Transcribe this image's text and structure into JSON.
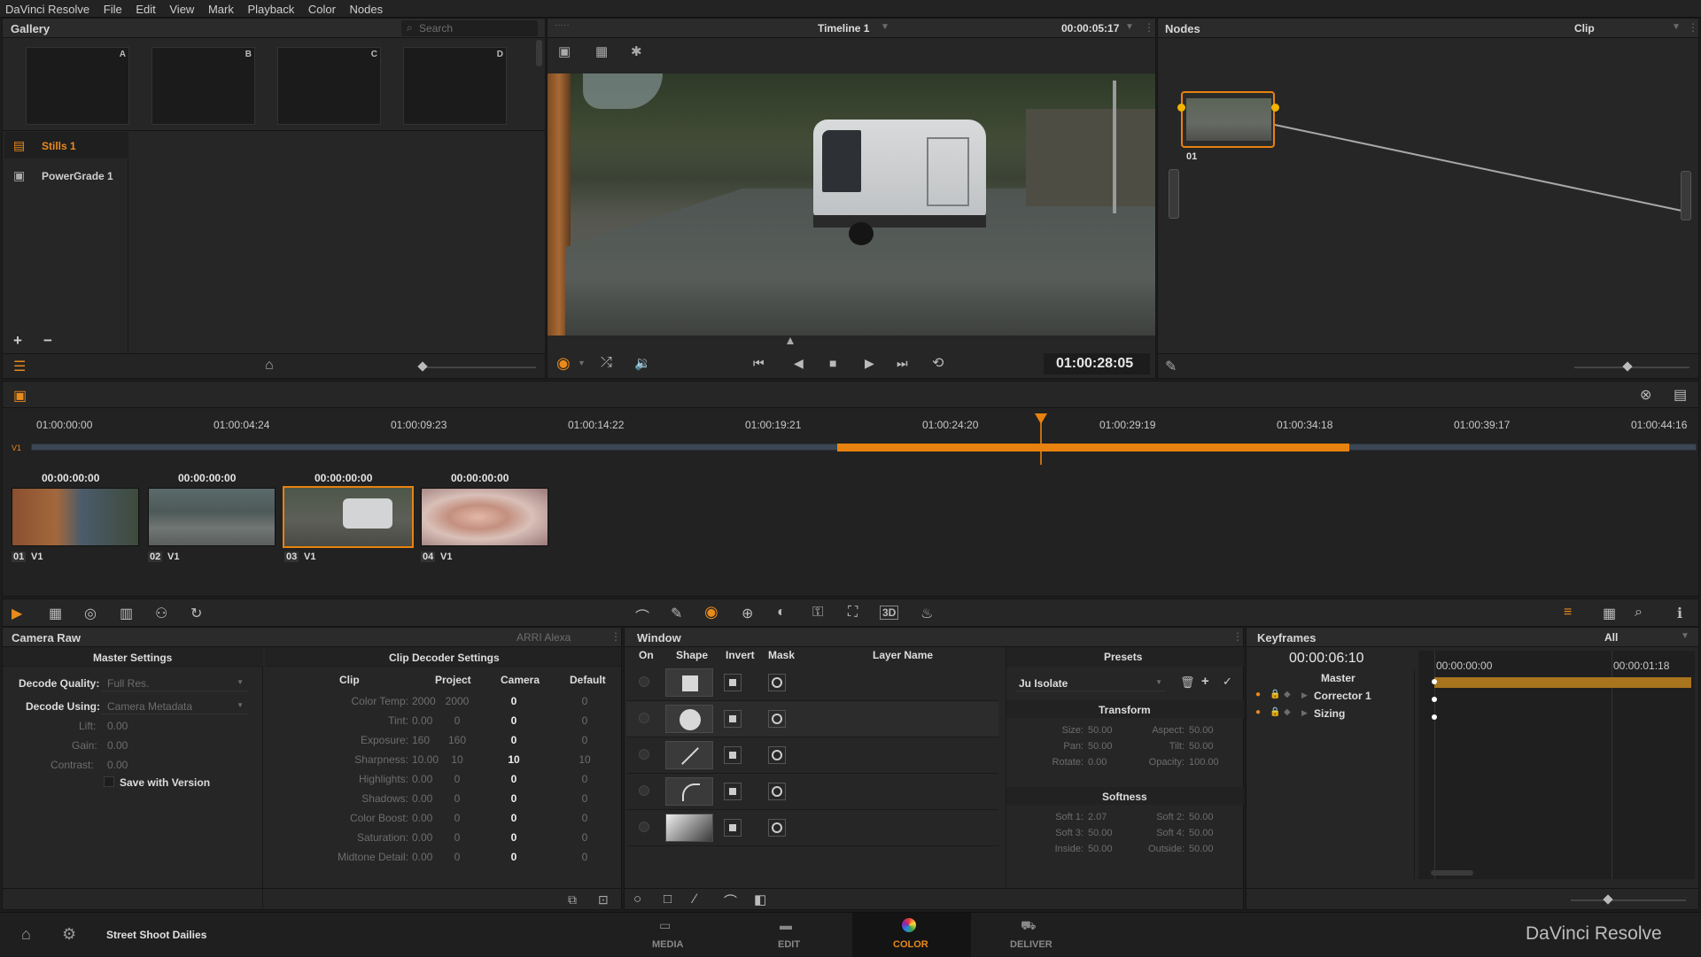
{
  "menu": {
    "items": [
      "DaVinci Resolve",
      "File",
      "Edit",
      "View",
      "Mark",
      "Playback",
      "Color",
      "Nodes"
    ]
  },
  "gallery": {
    "title": "Gallery",
    "search_placeholder": "Search",
    "slots": [
      "A",
      "B",
      "C",
      "D"
    ],
    "albums": [
      {
        "label": "Stills 1",
        "active": true
      },
      {
        "label": "PowerGrade 1",
        "active": false
      }
    ]
  },
  "viewer": {
    "timeline_name": "Timeline 1",
    "duration_tc": "00:00:05:17",
    "current_tc": "01:00:28:05"
  },
  "nodes": {
    "title": "Nodes",
    "mode": "Clip",
    "node_label": "01"
  },
  "timeline": {
    "ruler": [
      "01:00:00:00",
      "01:00:04:24",
      "01:00:09:23",
      "01:00:14:22",
      "01:00:19:21",
      "01:00:24:20",
      "01:00:29:19",
      "01:00:34:18",
      "01:00:39:17",
      "01:00:44:16"
    ],
    "track": "V1"
  },
  "clips": [
    {
      "tc": "00:00:00:00",
      "num": "01",
      "track": "V1",
      "selected": false
    },
    {
      "tc": "00:00:00:00",
      "num": "02",
      "track": "V1",
      "selected": false
    },
    {
      "tc": "00:00:00:00",
      "num": "03",
      "track": "V1",
      "selected": true
    },
    {
      "tc": "00:00:00:00",
      "num": "04",
      "track": "V1",
      "selected": false
    }
  ],
  "camera_raw": {
    "title": "Camera Raw",
    "camera": "ARRI Alexa",
    "master_title": "Master Settings",
    "decoder_title": "Clip Decoder Settings",
    "decode_quality_label": "Decode Quality:",
    "decode_quality": "Full Res.",
    "decode_using_label": "Decode Using:",
    "decode_using": "Camera Metadata",
    "lift_label": "Lift:",
    "lift": "0.00",
    "gain_label": "Gain:",
    "gain": "0.00",
    "contrast_label": "Contrast:",
    "contrast": "0.00",
    "save_with_version": "Save with Version",
    "columns": [
      "Clip",
      "Project",
      "Camera",
      "Default"
    ],
    "rows": [
      {
        "label": "Color Temp:",
        "clip": "2000",
        "project": "2000",
        "camera": "0",
        "default": "0"
      },
      {
        "label": "Tint:",
        "clip": "0.00",
        "project": "0",
        "camera": "0",
        "default": "0"
      },
      {
        "label": "Exposure:",
        "clip": "160",
        "project": "160",
        "camera": "0",
        "default": "0"
      },
      {
        "label": "Sharpness:",
        "clip": "10.00",
        "project": "10",
        "camera": "10",
        "default": "10"
      },
      {
        "label": "Highlights:",
        "clip": "0.00",
        "project": "0",
        "camera": "0",
        "default": "0"
      },
      {
        "label": "Shadows:",
        "clip": "0.00",
        "project": "0",
        "camera": "0",
        "default": "0"
      },
      {
        "label": "Color Boost:",
        "clip": "0.00",
        "project": "0",
        "camera": "0",
        "default": "0"
      },
      {
        "label": "Saturation:",
        "clip": "0.00",
        "project": "0",
        "camera": "0",
        "default": "0"
      },
      {
        "label": "Midtone Detail:",
        "clip": "0.00",
        "project": "0",
        "camera": "0",
        "default": "0"
      }
    ]
  },
  "window": {
    "title": "Window",
    "cols": [
      "On",
      "Shape",
      "Invert",
      "Mask",
      "Layer Name"
    ],
    "presets_title": "Presets",
    "preset": "Ju Isolate",
    "transform_title": "Transform",
    "transform": [
      [
        "Size:",
        "50.00"
      ],
      [
        "Aspect:",
        "50.00"
      ],
      [
        "Pan:",
        "50.00"
      ],
      [
        "Tilt:",
        "50.00"
      ],
      [
        "Rotate:",
        "0.00"
      ],
      [
        "Opacity:",
        "100.00"
      ]
    ],
    "softness_title": "Softness",
    "softness": [
      [
        "Soft 1:",
        "2.07"
      ],
      [
        "Soft 2:",
        "50.00"
      ],
      [
        "Soft 3:",
        "50.00"
      ],
      [
        "Soft 4:",
        "50.00"
      ],
      [
        "Inside:",
        "50.00"
      ],
      [
        "Outside:",
        "50.00"
      ]
    ]
  },
  "keyframes": {
    "title": "Keyframes",
    "filter": "All",
    "current_tc": "00:00:06:10",
    "ruler": [
      "00:00:00:00",
      "00:00:01:18"
    ],
    "tracks": [
      "Master",
      "Corrector 1",
      "Sizing"
    ]
  },
  "footer": {
    "project": "Street Shoot Dailies",
    "pages": [
      "MEDIA",
      "EDIT",
      "COLOR",
      "DELIVER"
    ],
    "brand": "DaVinci Resolve"
  },
  "colors": {
    "accent": "#e8820e",
    "bg": "#1d1d1d",
    "panel": "#262626"
  }
}
